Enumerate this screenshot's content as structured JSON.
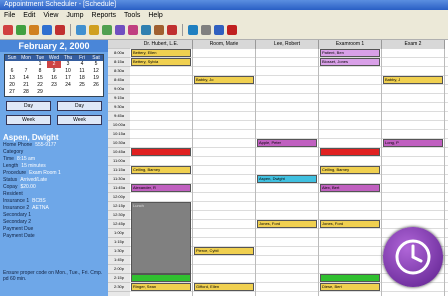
{
  "app": {
    "title": "Appointment Scheduler - [Schedule]"
  },
  "menu": [
    "File",
    "Edit",
    "View",
    "Jump",
    "Reports",
    "Tools",
    "Help"
  ],
  "toolbar": {
    "icons": [
      "patient-icon",
      "appt-icon",
      "user-icon",
      "user-add-icon",
      "report-icon",
      "print-icon",
      "tools-icon",
      "calendar-icon",
      "find-icon",
      "refresh-icon",
      "copy-icon",
      "paste-icon",
      "delete-icon",
      "settings-icon",
      "help-icon",
      "info-icon",
      "exit-icon"
    ]
  },
  "date_header": "February 2, 2000",
  "calendar": {
    "days": [
      "Sun",
      "Mon",
      "Tue",
      "Wed",
      "Thu",
      "Fri",
      "Sat"
    ],
    "weeks": [
      [
        "",
        "",
        "1",
        "2",
        "3",
        "4",
        "5"
      ],
      [
        "6",
        "7",
        "8",
        "9",
        "10",
        "11",
        "12"
      ],
      [
        "13",
        "14",
        "15",
        "16",
        "17",
        "18",
        "19"
      ],
      [
        "20",
        "21",
        "22",
        "23",
        "24",
        "25",
        "26"
      ],
      [
        "27",
        "28",
        "29",
        "",
        "",
        "",
        ""
      ]
    ],
    "selected": "2"
  },
  "nav": {
    "day_prev": "Day",
    "day_next": "Day",
    "week_prev": "Week",
    "week_next": "Week"
  },
  "patient": {
    "name": "Aspen, Dwight",
    "fields": [
      {
        "label": "Home Phone",
        "value": "555-9177"
      },
      {
        "label": "Category",
        "value": ""
      },
      {
        "label": "Time",
        "value": "8:15 am"
      },
      {
        "label": "Length",
        "value": "15 minutes"
      },
      {
        "label": "Procedure",
        "value": "Exam Room 1"
      },
      {
        "label": "Status",
        "value": "Arrived/Late"
      },
      {
        "label": "Copay",
        "value": "$20.00"
      },
      {
        "label": "Resident",
        "value": ""
      },
      {
        "label": "Insurance 1",
        "value": "BCBS"
      },
      {
        "label": "Insurance 2",
        "value": "AETNA"
      },
      {
        "label": "Secondary 1",
        "value": ""
      },
      {
        "label": "Secondary 2",
        "value": ""
      },
      {
        "label": "Payment Due",
        "value": ""
      },
      {
        "label": "Payment Date",
        "value": ""
      }
    ],
    "note": "Ensure proper code on Mon., Tue., Fri. Cmp. pd 60 min."
  },
  "times": [
    "8:00a",
    "8:15a",
    "8:30a",
    "8:45a",
    "9:00a",
    "9:15a",
    "9:30a",
    "9:45a",
    "10:00a",
    "10:15a",
    "10:30a",
    "10:45a",
    "11:00a",
    "11:15a",
    "11:30a",
    "11:45a",
    "12:00p",
    "12:15p",
    "12:30p",
    "12:45p",
    "1:00p",
    "1:15p",
    "1:30p",
    "1:45p",
    "2:00p",
    "2:15p",
    "2:30p"
  ],
  "columns": [
    "Dr. Hubert, L.E.",
    "Room, Marie",
    "Lee, Robert",
    "Examroom 1",
    "Exam 2"
  ],
  "appointments": [
    {
      "col": 0,
      "row": 0,
      "text": "Bettery, Ellen",
      "color": "#f0d050"
    },
    {
      "col": 0,
      "row": 1,
      "text": "Bettery, Sylvia",
      "color": "#f0d050"
    },
    {
      "col": 3,
      "row": 0,
      "text": "Patient, Ben",
      "color": "#d9a0e8"
    },
    {
      "col": 3,
      "row": 1,
      "text": "Blosset, Jones",
      "color": "#d9a0e8"
    },
    {
      "col": 1,
      "row": 3,
      "text": "Babby, Jo",
      "color": "#f0d050"
    },
    {
      "col": 4,
      "row": 3,
      "text": "Babby, J",
      "color": "#f0d050"
    },
    {
      "col": 2,
      "row": 10,
      "text": "Apple, Peter",
      "color": "#c060c0"
    },
    {
      "col": 4,
      "row": 10,
      "text": "Long, P",
      "color": "#c060c0"
    },
    {
      "col": 0,
      "row": 11,
      "text": "",
      "color": "#e02020"
    },
    {
      "col": 3,
      "row": 11,
      "text": "",
      "color": "#e02020"
    },
    {
      "col": 0,
      "row": 13,
      "text": "Ceiling, Barney",
      "color": "#f0d050"
    },
    {
      "col": 3,
      "row": 13,
      "text": "Ceiling, Barney",
      "color": "#f0d050"
    },
    {
      "col": 2,
      "row": 14,
      "text": "Aspen, Dwight",
      "color": "#40c0e0"
    },
    {
      "col": 0,
      "row": 15,
      "text": "Alexander, R",
      "color": "#c060c0"
    },
    {
      "col": 3,
      "row": 15,
      "text": "Alex, Bert",
      "color": "#c060c0"
    },
    {
      "col": 2,
      "row": 19,
      "text": "Jones, Ford",
      "color": "#f0d050"
    },
    {
      "col": 3,
      "row": 19,
      "text": "Jones, Ford",
      "color": "#f0d050"
    },
    {
      "col": 1,
      "row": 22,
      "text": "Pierce, Cybil",
      "color": "#f0d050"
    },
    {
      "col": 0,
      "row": 25,
      "text": "",
      "color": "#30c030"
    },
    {
      "col": 3,
      "row": 25,
      "text": "",
      "color": "#30c030"
    },
    {
      "col": 0,
      "row": 26,
      "text": "Ringer, Sean",
      "color": "#f0d050"
    },
    {
      "col": 1,
      "row": 26,
      "text": "Gifford, Ellen",
      "color": "#f0d050"
    },
    {
      "col": 3,
      "row": 26,
      "text": "Diese, Bert",
      "color": "#f0d050"
    }
  ],
  "blocked": {
    "col": 0,
    "row_start": 17,
    "row_end": 25,
    "label": "Lunch",
    "color": "#808080"
  },
  "badge": {
    "icon": "clock-icon",
    "color": "#7a2fb0"
  }
}
